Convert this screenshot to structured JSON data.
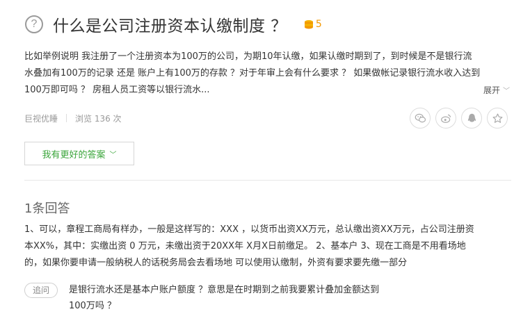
{
  "question": {
    "title": "什么是公司注册资本认缴制度 ？",
    "reward": "5",
    "body": "比如举例说明 我注册了一个注册资本为100万的公司，为期10年认缴，如果认缴时期到了，到时候是不是银行流\n水叠加有100万的记录 还是 账户上有100万的存款 ？对于年审上会有什么要求 ？ 如果做帐记录银行流水收入达到\n100万即可吗 ？ 房租人员工资等以银行流水...",
    "expand_label": "展开",
    "author": "巨视优睡",
    "views": "浏览 136 次"
  },
  "share": {
    "icons": [
      "wechat-icon",
      "weibo-icon",
      "qq-icon",
      "favorite-icon"
    ]
  },
  "better_answer_label": "我有更好的答案",
  "answers": {
    "count_label": "1条回答",
    "items": [
      {
        "text": "1、可以，章程工商局有样办，一般是这样写的：XXX ，以货币出资XX万元，总认缴出资XX万元，占公司注册资\n本XX%，其中：实缴出资 0 万元，未缴出资于20XX年 X月X日前缴足。 2、基本户 3、现在工商是不用看场地\n的，如果你要申请一般纳税人的话税务局会去看场地 可以使用认缴制，外资有要求要先缴一部分",
        "followup_label": "追问",
        "followup_text": "是银行流水还是基本户账户额度 ？意思是在时期到之前我要累计叠加金额达到\n100万吗 ？"
      }
    ]
  },
  "colors": {
    "accent_green": "#3aa53a",
    "coin_orange": "#f39800",
    "text": "#333333",
    "muted": "#999999"
  }
}
